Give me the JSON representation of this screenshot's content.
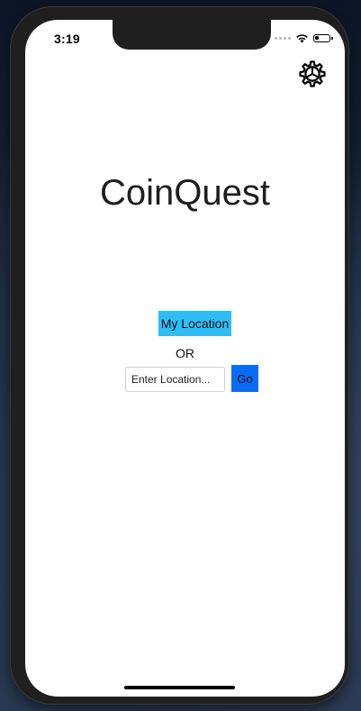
{
  "status_bar": {
    "time": "3:19",
    "battery_level": 0.25
  },
  "header": {
    "settings_icon": "gear-icon"
  },
  "main": {
    "title": "CoinQuest",
    "my_location_label": "My Location",
    "or_label": "OR",
    "location_input": {
      "value": "",
      "placeholder": "Enter Location..."
    },
    "go_label": "Go"
  },
  "colors": {
    "my_location_button": "#2fbdf5",
    "go_button": "#0a6cf5",
    "screen_background": "#ffffff"
  }
}
